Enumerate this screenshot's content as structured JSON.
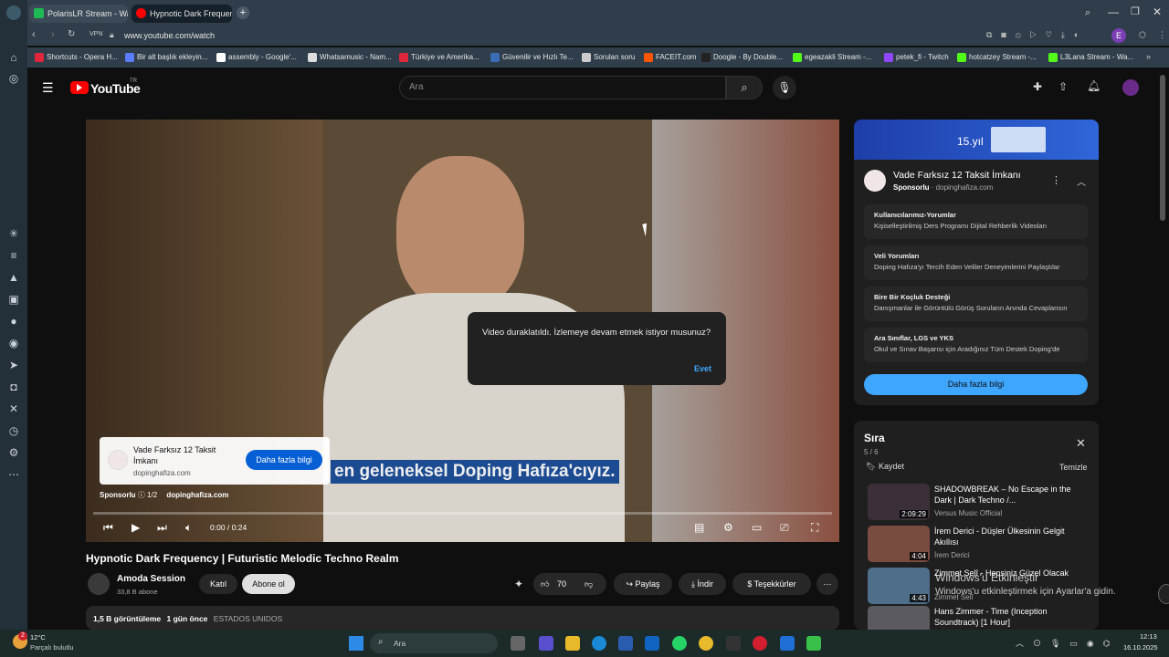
{
  "browser": {
    "tabs": [
      {
        "label": "PolarisLR Stream - Watch",
        "color": "#1db954"
      },
      {
        "label": "Hypnotic Dark Frequenc",
        "color": "#ff0000"
      }
    ],
    "new_tab": "+",
    "vpn": "VPN",
    "url": "www.youtube.com/watch",
    "profile": "E",
    "bookmarks": [
      {
        "label": "Shortcuts - Opera H...",
        "color": "#e0263a"
      },
      {
        "label": "Bir alt başlık ekleyin...",
        "color": "#5b7cff"
      },
      {
        "label": "assembly - Google'...",
        "color": "#ffffff"
      },
      {
        "label": "Whatsamusic - Nam...",
        "color": "#dddddd"
      },
      {
        "label": "Türkiye ve Amerika...",
        "color": "#e0263a"
      },
      {
        "label": "Güvenilir ve Hızlı Te...",
        "color": "#3a6db5"
      },
      {
        "label": "Sorulan soru",
        "color": "#cccccc"
      },
      {
        "label": "FACEIT.com",
        "color": "#ff5500"
      },
      {
        "label": "Doogle - By Double...",
        "color": "#222222"
      },
      {
        "label": "egeazakli Stream -...",
        "color": "#53fc18"
      },
      {
        "label": "petek_fi - Twitch",
        "color": "#9146ff"
      },
      {
        "label": "hotcatzey Stream -...",
        "color": "#53fc18"
      },
      {
        "label": "L3Lana Stream - Wa...",
        "color": "#53fc18"
      }
    ]
  },
  "youtube": {
    "logo": "YouTube",
    "country": "TR",
    "search_placeholder": "Ara",
    "video": {
      "subtitle": "en geleneksel Doping Hafıza'cıyız.",
      "time": "0:00 / 0:24",
      "ad_label": "Sponsorlu",
      "ad_count": "1/2",
      "ad_domain": "dopinghafiza.com",
      "ad_title": "Vade Farksız 12 Taksit İmkanı",
      "ad_site": "dopinghafiza.com",
      "ad_button": "Daha fazla bilgi",
      "pause_dialog": "Video duraklatıldı. İzlemeye devam etmek istiyor musunuz?",
      "pause_yes": "Evet",
      "progress": 0
    },
    "title": "Hypnotic Dark Frequency | Futuristic Melodic Techno Realm",
    "channel": "Amoda Session",
    "subs": "33,8 B abone",
    "join": "Katıl",
    "subscribe": "Abone ol",
    "likes": "70",
    "share": "Paylaş",
    "download": "İndir",
    "thanks": "Teşekkürler",
    "views": "1,5 B görüntüleme",
    "age": "1 gün önce",
    "tag": "ESTADOS UNIDOS",
    "sponsor": {
      "banner_text": "15.yıl",
      "title": "Vade Farksız 12 Taksit İmkanı",
      "label": "Sponsorlu",
      "domain": "dopinghafiza.com",
      "items": [
        {
          "t": "Kullanıcılarımız-Yorumlar",
          "s": "Kişiselleştirilmiş Ders Programı Dijital Rehberlik Videoları"
        },
        {
          "t": "Veli Yorumları",
          "s": "Doping Hafıza'yı Tercih Eden Veliler Deneyimlerini Paylaştılar"
        },
        {
          "t": "Bire Bir Koçluk Desteği",
          "s": "Danışmanlar ile Görüntülü Görüş Soruların Anında Cevaplansın"
        },
        {
          "t": "Ara Sınıflar, LGS ve YKS",
          "s": "Okul ve Sınav Başarısı için Aradığınız Tüm Destek Doping'de"
        }
      ],
      "cta": "Daha fazla bilgi"
    },
    "queue": {
      "title": "Sıra",
      "count": "5 / 6",
      "save": "Kaydet",
      "clear": "Temizle",
      "items": [
        {
          "t": "SHADOWBREAK – No Escape in the Dark | Dark Techno /...",
          "c": "Versus Music Official",
          "d": "2:09:29",
          "color": "#3b2f3a"
        },
        {
          "t": "İrem Derici - Düşler Ülkesinin Gelgit Akıllısı",
          "c": "İrem Derici",
          "d": "4:04",
          "color": "#7a4b3f"
        },
        {
          "t": "Zimmet Selî - Hepsiniz Güzel Olacak",
          "c": "Zimmet Selî",
          "d": "4:43",
          "color": "#4f6e8a"
        },
        {
          "t": "Hans Zimmer - Time (Inception Soundtrack) [1 Hour]",
          "c": "",
          "d": "",
          "color": "#5a5a60"
        }
      ]
    }
  },
  "windows_overlay": {
    "title": "Windows'u Etkinleştir",
    "sub": "Windows'u etkinleştirmek için Ayarlar'a gidin."
  },
  "taskbar": {
    "weather_temp": "12°C",
    "weather_desc": "Parçalı bulutlu",
    "search": "Ara",
    "time": "12:13",
    "date": "16.10.2025",
    "badge": "2"
  }
}
